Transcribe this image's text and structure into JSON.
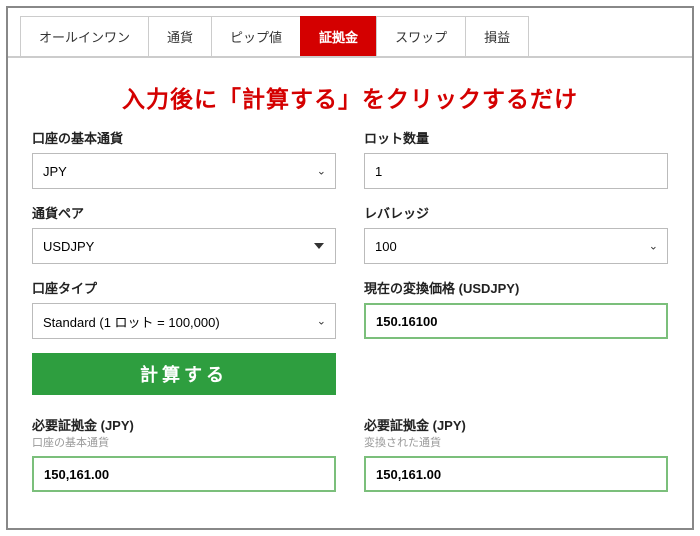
{
  "tabs": {
    "all_in_one": "オールインワン",
    "currency": "通貨",
    "pip": "ピップ値",
    "margin": "証拠金",
    "swap": "スワップ",
    "pl": "損益"
  },
  "headline": "入力後に「計算する」をクリックするだけ",
  "labels": {
    "base_currency": "口座の基本通貨",
    "lot_size": "ロット数量",
    "pair": "通貨ペア",
    "leverage": "レバレッジ",
    "account_type": "口座タイプ",
    "conversion_price": "現在の変換価格 (USDJPY)",
    "required_margin_left": "必要証拠金 (JPY)",
    "required_margin_left_sub": "口座の基本通貨",
    "required_margin_right": "必要証拠金 (JPY)",
    "required_margin_right_sub": "変換された通貨"
  },
  "values": {
    "base_currency": "JPY",
    "lot_size": "1",
    "pair": "USDJPY",
    "leverage": "100",
    "account_type": "Standard (1 ロット = 100,000)",
    "conversion_price": "150.16100",
    "margin_left": "150,161.00",
    "margin_right": "150,161.00"
  },
  "buttons": {
    "calculate": "計算する"
  }
}
